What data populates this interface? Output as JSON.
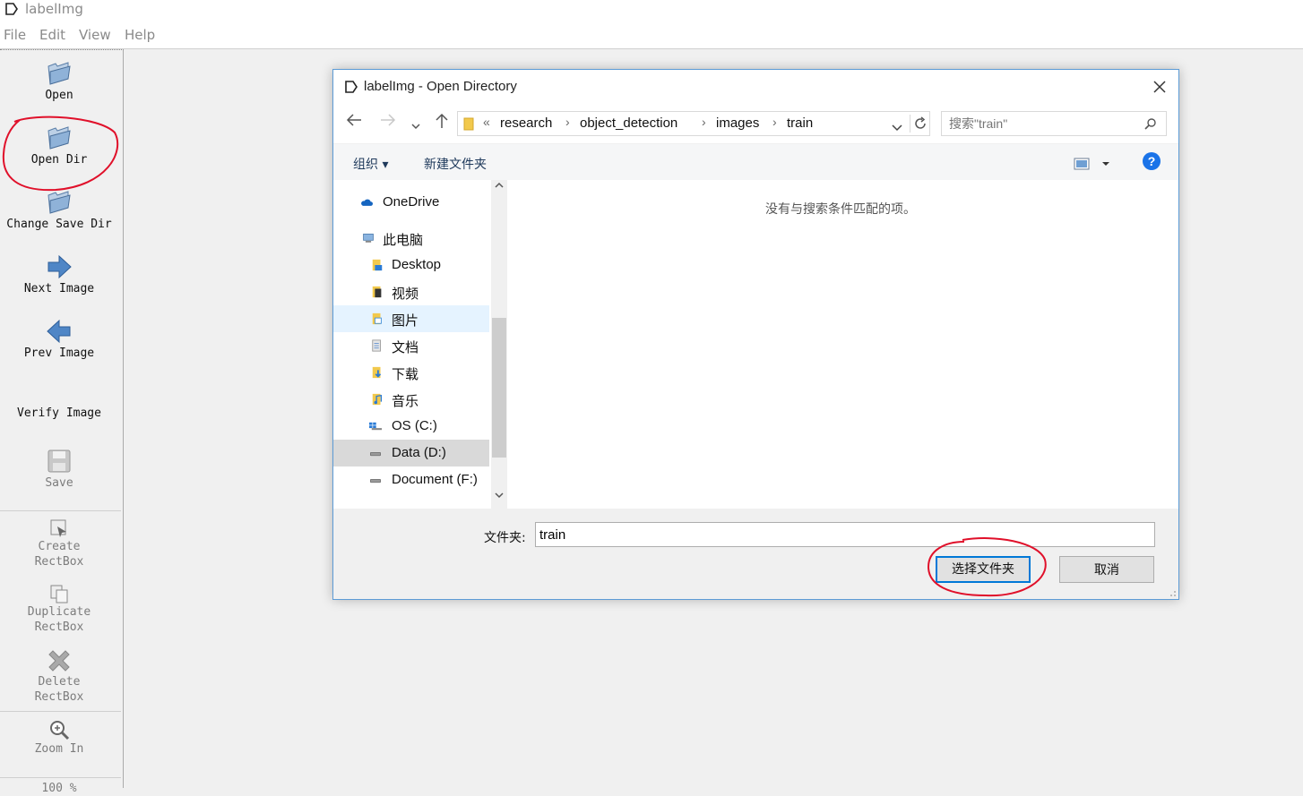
{
  "app": {
    "title": "labelImg"
  },
  "menu": [
    "File",
    "Edit",
    "View",
    "Help"
  ],
  "toolbar": {
    "open": "Open",
    "open_dir": "Open Dir",
    "change_save_dir": "Change Save Dir",
    "next_image": "Next Image",
    "prev_image": "Prev Image",
    "verify_image": "Verify Image",
    "save": "Save",
    "create_rectbox_1": "Create",
    "create_rectbox_2": "RectBox",
    "duplicate_rectbox_1": "Duplicate",
    "duplicate_rectbox_2": "RectBox",
    "delete_rectbox_1": "Delete",
    "delete_rectbox_2": "RectBox",
    "zoom_in": "Zoom In",
    "zoom_level": "100 %"
  },
  "dialog": {
    "title": "labelImg - Open Directory",
    "breadcrumb_prefix": "«",
    "breadcrumb": [
      "research",
      "object_detection",
      "images",
      "train"
    ],
    "search_placeholder": "搜索\"train\"",
    "organize": "组织 ▾",
    "new_folder": "新建文件夹",
    "nav": {
      "onedrive": "OneDrive",
      "this_pc": "此电脑",
      "desktop": "Desktop",
      "videos": "视频",
      "pictures": "图片",
      "documents": "文档",
      "downloads": "下载",
      "music": "音乐",
      "os_c": "OS (C:)",
      "data_d": "Data (D:)",
      "document_f": "Document (F:)"
    },
    "empty_message": "没有与搜索条件匹配的项。",
    "folder_label": "文件夹:",
    "folder_value": "train",
    "select_button": "选择文件夹",
    "cancel_button": "取消"
  },
  "colors": {
    "accent": "#0078d7",
    "annotation": "#e0102a"
  }
}
